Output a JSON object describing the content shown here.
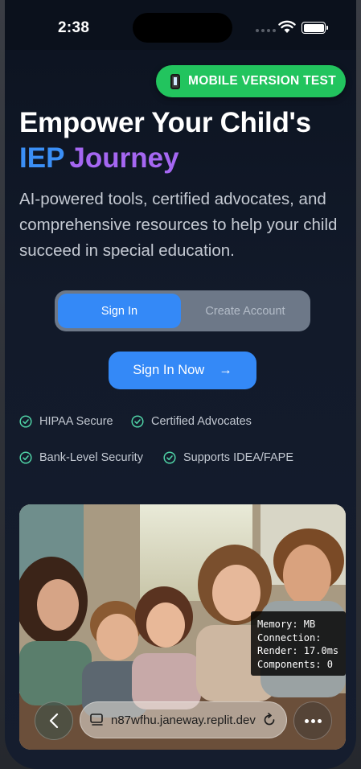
{
  "status_bar": {
    "time": "2:38"
  },
  "badge": {
    "label": "MOBILE VERSION TEST"
  },
  "hero": {
    "headline_line1": "Empower Your Child's",
    "headline_iep": "IEP",
    "headline_journey": "Journey",
    "subtitle": "AI-powered tools, certified advocates, and comprehensive resources to help your child succeed in special education."
  },
  "auth_toggle": {
    "sign_in": "Sign In",
    "create_account": "Create Account"
  },
  "cta": {
    "label": "Sign In Now",
    "arrow": "→"
  },
  "features": [
    {
      "label": "HIPAA Secure"
    },
    {
      "label": "Certified Advocates"
    },
    {
      "label": "Bank-Level Security"
    },
    {
      "label": "Supports IDEA/FAPE"
    }
  ],
  "perf_panel": {
    "memory": "Memory: MB",
    "connection": "Connection:",
    "render": "Render: 17.0ms",
    "components": "Components: 0"
  },
  "browser": {
    "url": "n87wfhu.janeway.replit.dev"
  },
  "colors": {
    "accent_blue": "#3489f7",
    "badge_green": "#22c45e",
    "journey_purple": "#a567f2",
    "check_green": "#4fd1a5"
  },
  "icons": [
    "phone-icon",
    "wifi-icon",
    "battery-icon",
    "arrow-right-icon",
    "check-circle-icon",
    "chevron-left-icon",
    "tabs-icon",
    "reload-icon",
    "more-icon"
  ]
}
